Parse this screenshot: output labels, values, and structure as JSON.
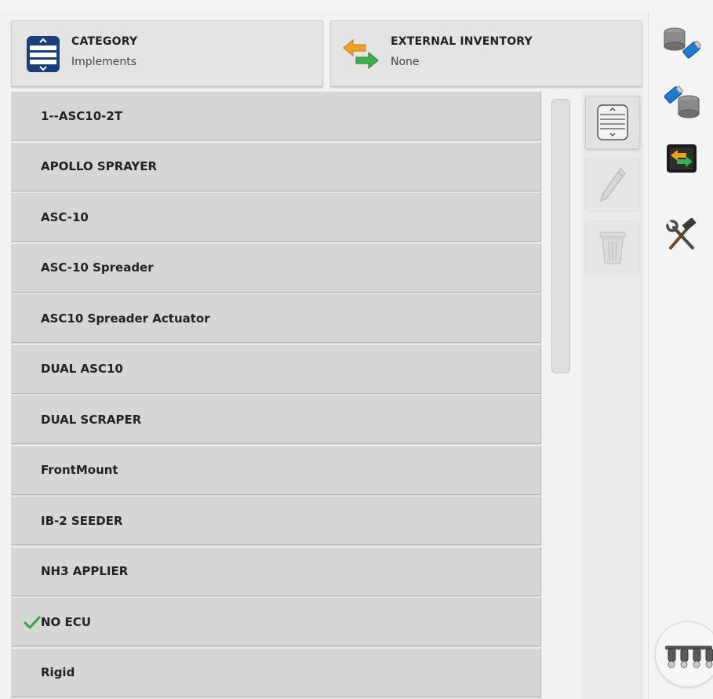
{
  "header": {
    "category": {
      "title": "CATEGORY",
      "value": "Implements",
      "icon": "list-selector-icon"
    },
    "external_inventory": {
      "title": "EXTERNAL INVENTORY",
      "value": "None",
      "icon": "transfer-arrows-icon"
    }
  },
  "list": {
    "items": [
      {
        "label": "1--ASC10-2T",
        "selected": false
      },
      {
        "label": "APOLLO SPRAYER",
        "selected": false
      },
      {
        "label": "ASC-10",
        "selected": false
      },
      {
        "label": "ASC-10 Spreader",
        "selected": false
      },
      {
        "label": "ASC10 Spreader Actuator",
        "selected": false
      },
      {
        "label": "DUAL ASC10",
        "selected": false
      },
      {
        "label": "DUAL SCRAPER",
        "selected": false
      },
      {
        "label": "FrontMount",
        "selected": false
      },
      {
        "label": "IB-2 SEEDER",
        "selected": false
      },
      {
        "label": "NH3 APPLIER",
        "selected": false
      },
      {
        "label": "NO ECU",
        "selected": true
      },
      {
        "label": "Rigid",
        "selected": false
      }
    ]
  },
  "actions": [
    {
      "name": "select-list-button",
      "icon": "list-selector-icon",
      "enabled": true
    },
    {
      "name": "edit-button",
      "icon": "pencil-icon",
      "enabled": false
    },
    {
      "name": "delete-button",
      "icon": "trash-icon",
      "enabled": false
    }
  ],
  "sidebar": [
    {
      "name": "import-from-usb-button",
      "icon": "database-to-usb-icon"
    },
    {
      "name": "export-to-usb-button",
      "icon": "usb-to-database-icon"
    },
    {
      "name": "transfer-button",
      "icon": "transfer-arrows-icon"
    },
    {
      "name": "tools-button",
      "icon": "hammer-wrench-icon"
    }
  ],
  "colors": {
    "accent_blue": "#1c3f7a",
    "check_green": "#3aa14a",
    "arrow_orange": "#f0a020",
    "arrow_green": "#3db04a"
  }
}
